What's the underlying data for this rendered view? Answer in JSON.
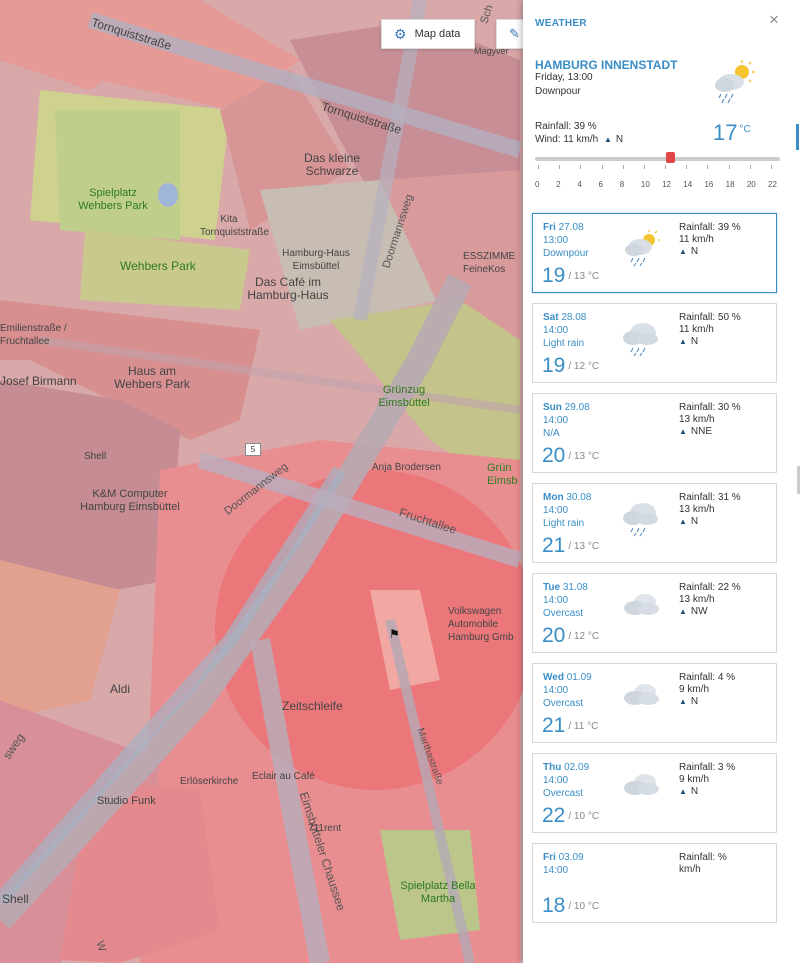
{
  "map": {
    "buttons": {
      "map_data": "Map data"
    },
    "labels": [
      "Tornquiststraße",
      "Tornquiststraße",
      "Das kleine Schwarze",
      "Spielplatz Wehbers Park",
      "Kita Tornquiststraße",
      "Hamburg-Haus Eimsbüttel",
      "Wehbers Park",
      "Das Café im Hamburg-Haus",
      "Doormannsweg",
      "ESSZIMME FeineKos",
      "Emilienstraße / Fruchtallee",
      "Haus am Wehbers Park",
      "Josef Birmann",
      "Grünzug Eimsbüttel",
      "Shell",
      "Anja Brodersen",
      "Grün Eimsb",
      "K&M Computer Hamburg Eimsbüttel",
      "Doormannsweg",
      "Fruchtallee",
      "Volkswagen Automobile Hamburg Gmb",
      "Aldi",
      "Zeitschleife",
      "Marthastraße",
      "Eimsbütteler Chaussee",
      "Erlöserkirche",
      "Eclair au Café",
      "Studio Funk",
      "711rent",
      "Spielplatz Bella Martha",
      "Shell",
      "sweg",
      "Magyver",
      "Sch",
      "W"
    ],
    "route_badge": "5"
  },
  "panel": {
    "title": "WEATHER",
    "close": "×",
    "location": "HAMBURG INNENSTADT",
    "datetime": "Friday, 13:00",
    "condition": "Downpour",
    "rainfall": "Rainfall: 39 %",
    "wind_prefix": "Wind: 11 km/h",
    "wind_dir": "N",
    "temp": "17",
    "temp_unit": "°C",
    "slider_hour": 13,
    "slider_ticks": [
      "0",
      "2",
      "4",
      "6",
      "8",
      "10",
      "12",
      "14",
      "16",
      "18",
      "20",
      "22"
    ]
  },
  "forecast": [
    {
      "dow": "Fri",
      "date": "27.08",
      "time": "13:00",
      "cond": "Downpour",
      "hi": "19",
      "lo": "/ 13 °C",
      "rain": "Rainfall: 39 %",
      "wind": "11 km/h",
      "dir": "N",
      "icon": "sun-cloud-rain-icon",
      "selected": true
    },
    {
      "dow": "Sat",
      "date": "28.08",
      "time": "14:00",
      "cond": "Light rain",
      "hi": "19",
      "lo": "/ 12 °C",
      "rain": "Rainfall: 50 %",
      "wind": "11 km/h",
      "dir": "N",
      "icon": "cloud-rain-icon"
    },
    {
      "dow": "Sun",
      "date": "29.08",
      "time": "14:00",
      "cond": "N/A",
      "hi": "20",
      "lo": "/ 13 °C",
      "rain": "Rainfall: 30 %",
      "wind": "13 km/h",
      "dir": "NNE",
      "icon": ""
    },
    {
      "dow": "Mon",
      "date": "30.08",
      "time": "14:00",
      "cond": "Light rain",
      "hi": "21",
      "lo": "/ 13 °C",
      "rain": "Rainfall: 31 %",
      "wind": "13 km/h",
      "dir": "N",
      "icon": "cloud-rain-icon"
    },
    {
      "dow": "Tue",
      "date": "31.08",
      "time": "14:00",
      "cond": "Overcast",
      "hi": "20",
      "lo": "/ 12 °C",
      "rain": "Rainfall: 22 %",
      "wind": "13 km/h",
      "dir": "NW",
      "icon": "overcast-icon"
    },
    {
      "dow": "Wed",
      "date": "01.09",
      "time": "14:00",
      "cond": "Overcast",
      "hi": "21",
      "lo": "/ 11 °C",
      "rain": "Rainfall: 4 %",
      "wind": "9 km/h",
      "dir": "N",
      "icon": "overcast-icon"
    },
    {
      "dow": "Thu",
      "date": "02.09",
      "time": "14:00",
      "cond": "Overcast",
      "hi": "22",
      "lo": "/ 10 °C",
      "rain": "Rainfall: 3 %",
      "wind": "9 km/h",
      "dir": "N",
      "icon": "overcast-icon"
    },
    {
      "dow": "Fri",
      "date": "03.09",
      "time": "14:00",
      "cond": "",
      "hi": "18",
      "lo": "/ 10 °C",
      "rain": "Rainfall: %",
      "wind": "km/h",
      "dir": "",
      "icon": ""
    }
  ],
  "colors": {
    "accent": "#3a8ec7",
    "handle": "#e04646"
  }
}
